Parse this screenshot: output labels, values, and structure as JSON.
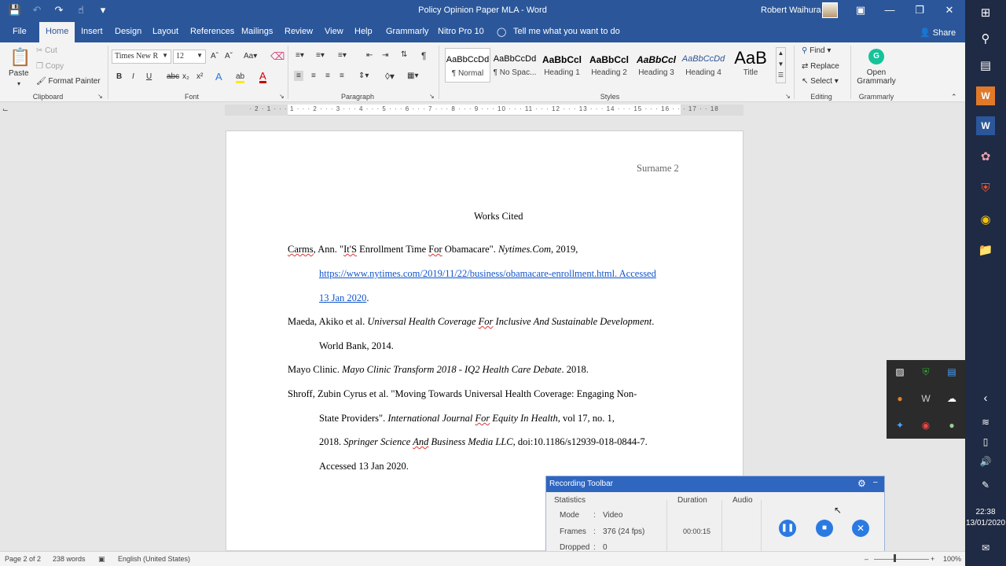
{
  "window": {
    "title": "Policy Opinion Paper MLA  -  Word",
    "user": "Robert Waihura"
  },
  "tabs": [
    "File",
    "Home",
    "Insert",
    "Design",
    "Layout",
    "References",
    "Mailings",
    "Review",
    "View",
    "Help",
    "Grammarly",
    "Nitro Pro 10"
  ],
  "active_tab": "Home",
  "tell_me": "Tell me what you want to do",
  "share": "Share",
  "ribbon": {
    "clipboard": {
      "label": "Clipboard",
      "paste": "Paste",
      "cut": "Cut",
      "copy": "Copy",
      "format_painter": "Format Painter"
    },
    "font": {
      "label": "Font",
      "family": "Times New R",
      "size": "12"
    },
    "paragraph": {
      "label": "Paragraph"
    },
    "styles": {
      "label": "Styles",
      "items": [
        {
          "sample": "AaBbCcDd",
          "name": "¶ Normal"
        },
        {
          "sample": "AaBbCcDd",
          "name": "¶ No Spac..."
        },
        {
          "sample": "AaBbCcl",
          "name": "Heading 1"
        },
        {
          "sample": "AaBbCcl",
          "name": "Heading 2"
        },
        {
          "sample": "AaBbCcl",
          "name": "Heading 3"
        },
        {
          "sample": "AaBbCcDd",
          "name": "Heading 4"
        },
        {
          "sample": "AaB",
          "name": "Title"
        }
      ]
    },
    "editing": {
      "label": "Editing",
      "find": "Find",
      "replace": "Replace",
      "select": "Select"
    },
    "grammarly": {
      "label": "Grammarly",
      "open": "Open",
      "grammarly": "Grammarly"
    }
  },
  "ruler": "· 2 · 1 · · · 1 · · · 2 · · · 3 · · · 4 · · · 5 · · · 6 · · · 7 · · · 8 · · · 9 · · · 10 · · · 11 · · · 12 · · · 13 · · · 14 · · · 15 · · · 16 · · · 17 · · 18",
  "document": {
    "header": "Surname 2",
    "heading": "Works Cited",
    "entries": {
      "e1_a": "Carms",
      "e1_b": ", Ann. \"",
      "e1_c": "It'S",
      "e1_d": " Enrollment Time ",
      "e1_e": "For",
      "e1_f": " Obamacare\". ",
      "e1_g": "Nytimes.Com",
      "e1_h": ", 2019,",
      "e1_link": "https://www.nytimes.com/2019/11/22/business/obamacare-enrollment.html. Accessed",
      "e1_link2": "13 Jan 2020",
      "e1_end": ".",
      "e2_a": "Maeda, Akiko et al. ",
      "e2_b": "Universal Health Coverage ",
      "e2_c": "For",
      "e2_d": " Inclusive And Sustainable Development",
      "e2_e": ".",
      "e2_line2": "World Bank, 2014.",
      "e3_a": "Mayo Clinic. ",
      "e3_b": "Mayo Clinic Transform 2018 - IQ2 Health Care Debate",
      "e3_c": ". 2018.",
      "e4_line1": "Shroff, Zubin Cyrus et al. \"Moving Towards Universal Health Coverage: Engaging Non-",
      "e4_line2a": "State Providers\". ",
      "e4_line2b": "International Journal ",
      "e4_line2c": "For",
      "e4_line2d": " Equity In Health",
      "e4_line2e": ", vol 17, no. 1,",
      "e4_line3a": "2018. ",
      "e4_line3b": "Springer Science ",
      "e4_line3c": "And",
      "e4_line3d": " Business Media LLC",
      "e4_line3e": ", doi:10.1186/s12939-018-0844-7.",
      "e4_line4": "Accessed 13 Jan 2020."
    }
  },
  "recording": {
    "title": "Recording Toolbar",
    "statistics": "Statistics",
    "duration_label": "Duration",
    "audio_label": "Audio",
    "mode_key": "Mode",
    "mode_val": "Video",
    "frames_key": "Frames",
    "frames_val": "376 (24 fps)",
    "dropped_key": "Dropped",
    "dropped_val": "0",
    "duration": "00:00:15",
    "colon": ":"
  },
  "status": {
    "page": "Page 2 of 2",
    "words": "238 words",
    "language": "English (United States)",
    "zoom": "100%"
  },
  "clock": {
    "time": "22:38",
    "date": "13/01/2020"
  },
  "colors": {
    "word_blue": "#2b579a",
    "taskbar": "#1f2a44",
    "rec_blue": "#2e66c0"
  }
}
